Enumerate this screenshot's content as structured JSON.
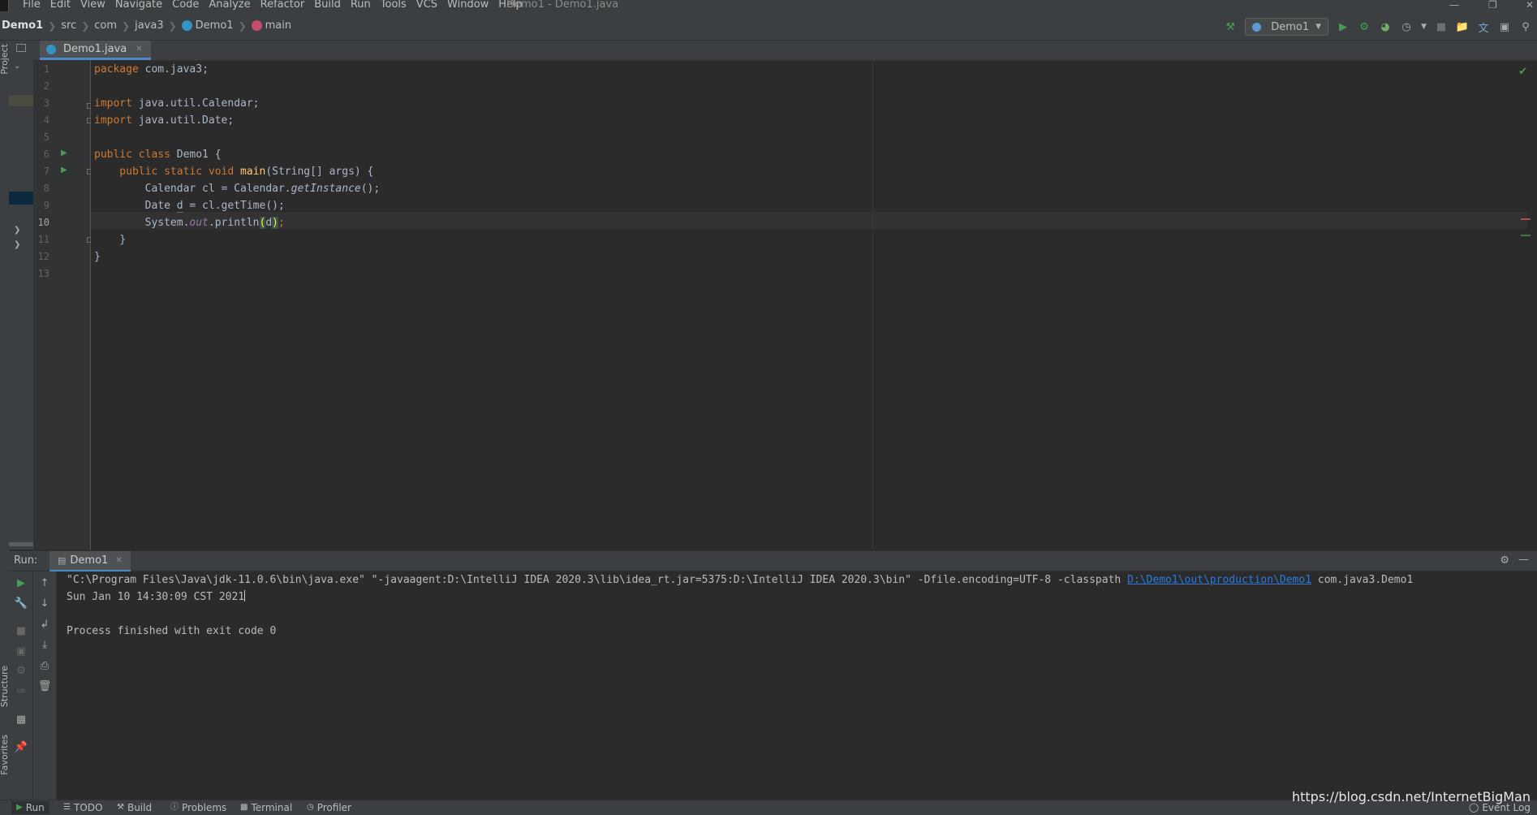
{
  "window": {
    "title": "Demo1 - Demo1.java"
  },
  "menu": [
    "File",
    "Edit",
    "View",
    "Navigate",
    "Code",
    "Analyze",
    "Refactor",
    "Build",
    "Run",
    "Tools",
    "VCS",
    "Window",
    "Help"
  ],
  "breadcrumb": {
    "project": "Demo1",
    "items": [
      "src",
      "com",
      "java3",
      "Demo1",
      "main"
    ]
  },
  "toolbar": {
    "run_config": "Demo1"
  },
  "left_strip": {
    "project_label": "Project",
    "structure_label": "Structure",
    "favorites_label": "Favorites"
  },
  "editor": {
    "tab_label": "Demo1.java",
    "current_line": 10,
    "line_numbers": [
      "1",
      "2",
      "3",
      "4",
      "5",
      "6",
      "7",
      "8",
      "9",
      "10",
      "11",
      "12",
      "13"
    ],
    "code": {
      "l1_kw": "package",
      "l1_rest": " com.java3;",
      "l3_kw": "import",
      "l3_rest": " java.util.Calendar;",
      "l4_kw": "import",
      "l4_rest": " java.util.Date;",
      "l6_kw": "public class",
      "l6_rest": " Demo1 {",
      "l7_kw": "    public static void",
      "l7_fn": " main",
      "l7_rest": "(String[] args) {",
      "l8_a": "        Calendar cl = Calendar.",
      "l8_it": "getInstance",
      "l8_b": "();",
      "l9_a": "        Date ",
      "l9_var": "d",
      "l9_b": " = cl.getTime();",
      "l10_a": "        System.",
      "l10_st": "out",
      "l10_b": ".println",
      "l10_p1": "(",
      "l10_var": "d",
      "l10_p2": ")",
      "l10_c": ";",
      "l11": "    }",
      "l12": "}"
    }
  },
  "run_panel": {
    "label": "Run:",
    "tab_label": "Demo1",
    "console": {
      "cmd_prefix": "\"C:\\Program Files\\Java\\jdk-11.0.6\\bin\\java.exe\" \"-javaagent:D:\\IntelliJ IDEA 2020.3\\lib\\idea_rt.jar=5375:D:\\IntelliJ IDEA 2020.3\\bin\" -Dfile.encoding=UTF-8 -classpath ",
      "cmd_link": "D:\\Demo1\\out\\production\\Demo1",
      "cmd_suffix": " com.java3.Demo1",
      "output": "Sun Jan 10 14:30:09 CST 2021",
      "exit": "Process finished with exit code 0"
    }
  },
  "bottom_bar": {
    "buttons": [
      "Run",
      "TODO",
      "Build",
      "Problems",
      "Terminal",
      "Profiler"
    ],
    "event_log": "Event Log"
  },
  "watermark": "https://blog.csdn.net/InternetBigMan",
  "colors": {
    "background": "#2b2b2b",
    "panel": "#3c3f41",
    "keyword": "#cc7832",
    "function": "#ffc66d",
    "static_field": "#9876aa",
    "run_green": "#499c54",
    "link": "#287bde"
  }
}
